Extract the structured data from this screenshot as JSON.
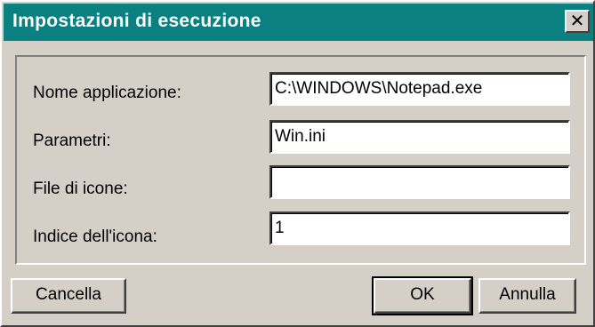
{
  "dialog": {
    "title": "Impostazioni di esecuzione",
    "close_glyph": "✕",
    "fields": [
      {
        "label": "Nome applicazione:",
        "value": "C:\\WINDOWS\\Notepad.exe"
      },
      {
        "label": "Parametri:",
        "value": "Win.ini"
      },
      {
        "label": "File di icone:",
        "value": ""
      },
      {
        "label": "Indice dell'icona:",
        "value": "1"
      }
    ],
    "buttons": {
      "clear": "Cancella",
      "ok": "OK",
      "cancel": "Annulla"
    }
  }
}
